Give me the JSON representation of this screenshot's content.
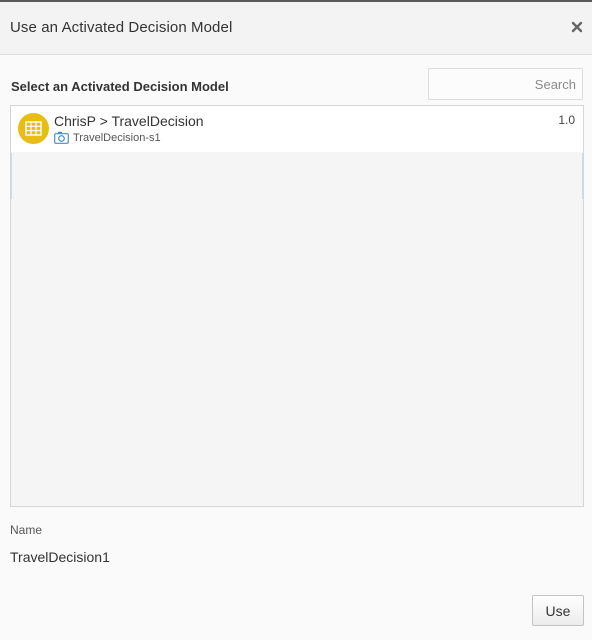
{
  "dialog": {
    "title": "Use an Activated Decision Model",
    "close_icon": "close-icon"
  },
  "select": {
    "label": "Select an Activated Decision Model",
    "search_placeholder": "Search",
    "search_value": ""
  },
  "list": {
    "items": [
      {
        "title": "ChrisP > TravelDecision",
        "subtitle": "TravelDecision-s1",
        "version": "1.0",
        "icon": "decision-table-icon",
        "sub_icon": "snapshot-camera-icon"
      }
    ]
  },
  "name_field": {
    "label": "Name",
    "value": "TravelDecision1"
  },
  "footer": {
    "use_label": "Use"
  },
  "colors": {
    "icon_badge": "#e8bd14",
    "camera_icon": "#4a8ec9",
    "header_bg": "#f3f3f3",
    "page_bg": "#fafafa"
  }
}
